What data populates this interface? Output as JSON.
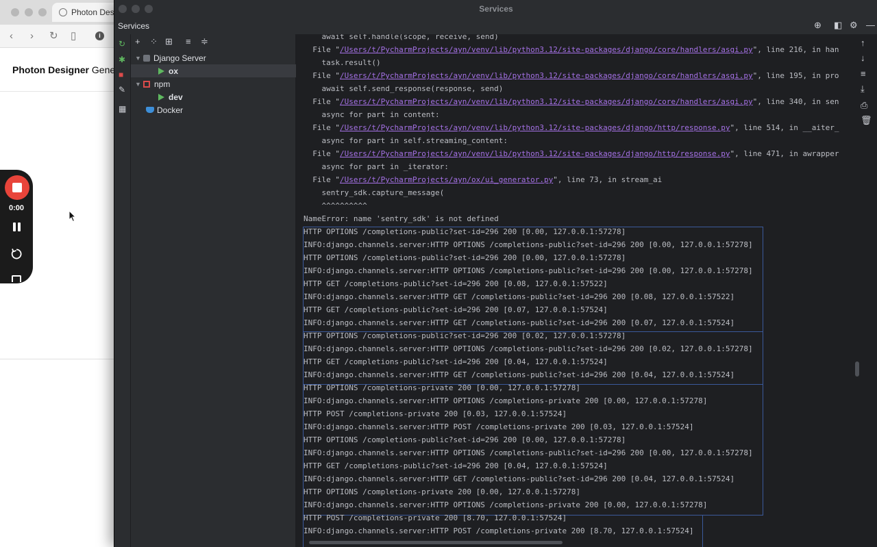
{
  "browser": {
    "tab_title": "Photon Desi",
    "site_brand": "Photon Designer",
    "site_title_rest": " Gene"
  },
  "recorder": {
    "time": "0:00"
  },
  "ide": {
    "window_title": "Services",
    "panel_label": "Services",
    "tree": [
      {
        "label": "Django Server",
        "type": "group"
      },
      {
        "label": "ox",
        "type": "run"
      },
      {
        "label": "npm",
        "type": "group"
      },
      {
        "label": "dev",
        "type": "run"
      },
      {
        "label": "Docker",
        "type": "docker"
      }
    ],
    "console": {
      "traceback": [
        {
          "pre": "    await self.handle(scope, receive, send)",
          "link": "",
          "post": ""
        },
        {
          "pre": "  File \"",
          "link": "/Users/t/PycharmProjects/ayn/venv/lib/python3.12/site-packages/django/core/handlers/asgi.py",
          "post": "\", line 216, in han"
        },
        {
          "pre": "    task.result()",
          "link": "",
          "post": ""
        },
        {
          "pre": "  File \"",
          "link": "/Users/t/PycharmProjects/ayn/venv/lib/python3.12/site-packages/django/core/handlers/asgi.py",
          "post": "\", line 195, in pro"
        },
        {
          "pre": "    await self.send_response(response, send)",
          "link": "",
          "post": ""
        },
        {
          "pre": "  File \"",
          "link": "/Users/t/PycharmProjects/ayn/venv/lib/python3.12/site-packages/django/core/handlers/asgi.py",
          "post": "\", line 340, in sen"
        },
        {
          "pre": "    async for part in content:",
          "link": "",
          "post": ""
        },
        {
          "pre": "  File \"",
          "link": "/Users/t/PycharmProjects/ayn/venv/lib/python3.12/site-packages/django/http/response.py",
          "post": "\", line 514, in __aiter_"
        },
        {
          "pre": "    async for part in self.streaming_content:",
          "link": "",
          "post": ""
        },
        {
          "pre": "  File \"",
          "link": "/Users/t/PycharmProjects/ayn/venv/lib/python3.12/site-packages/django/http/response.py",
          "post": "\", line 471, in awrapper"
        },
        {
          "pre": "    async for part in _iterator:",
          "link": "",
          "post": ""
        },
        {
          "pre": "  File \"",
          "link": "/Users/t/PycharmProjects/ayn/ox/ui_generator.py",
          "post": "\", line 73, in stream_ai"
        },
        {
          "pre": "    sentry_sdk.capture_message(",
          "link": "",
          "post": ""
        },
        {
          "pre": "    ^^^^^^^^^^",
          "link": "",
          "post": ""
        },
        {
          "pre": "NameError: name 'sentry_sdk' is not defined",
          "link": "",
          "post": ""
        }
      ],
      "log_lines": [
        "HTTP OPTIONS /completions-public?set-id=296 200 [0.00, 127.0.0.1:57278]",
        "INFO:django.channels.server:HTTP OPTIONS /completions-public?set-id=296 200 [0.00, 127.0.0.1:57278]",
        "HTTP OPTIONS /completions-public?set-id=296 200 [0.00, 127.0.0.1:57278]",
        "INFO:django.channels.server:HTTP OPTIONS /completions-public?set-id=296 200 [0.00, 127.0.0.1:57278]",
        "HTTP GET /completions-public?set-id=296 200 [0.08, 127.0.0.1:57522]",
        "INFO:django.channels.server:HTTP GET /completions-public?set-id=296 200 [0.08, 127.0.0.1:57522]",
        "HTTP GET /completions-public?set-id=296 200 [0.07, 127.0.0.1:57524]",
        "INFO:django.channels.server:HTTP GET /completions-public?set-id=296 200 [0.07, 127.0.0.1:57524]",
        "HTTP OPTIONS /completions-public?set-id=296 200 [0.02, 127.0.0.1:57278]",
        "INFO:django.channels.server:HTTP OPTIONS /completions-public?set-id=296 200 [0.02, 127.0.0.1:57278]",
        "HTTP GET /completions-public?set-id=296 200 [0.04, 127.0.0.1:57524]",
        "INFO:django.channels.server:HTTP GET /completions-public?set-id=296 200 [0.04, 127.0.0.1:57524]",
        "HTTP OPTIONS /completions-private 200 [0.00, 127.0.0.1:57278]",
        "INFO:django.channels.server:HTTP OPTIONS /completions-private 200 [0.00, 127.0.0.1:57278]",
        "HTTP POST /completions-private 200 [0.03, 127.0.0.1:57524]",
        "INFO:django.channels.server:HTTP POST /completions-private 200 [0.03, 127.0.0.1:57524]",
        "HTTP OPTIONS /completions-public?set-id=296 200 [0.00, 127.0.0.1:57278]",
        "INFO:django.channels.server:HTTP OPTIONS /completions-public?set-id=296 200 [0.00, 127.0.0.1:57278]",
        "HTTP GET /completions-public?set-id=296 200 [0.04, 127.0.0.1:57524]",
        "INFO:django.channels.server:HTTP GET /completions-public?set-id=296 200 [0.04, 127.0.0.1:57524]",
        "HTTP OPTIONS /completions-private 200 [0.00, 127.0.0.1:57278]",
        "INFO:django.channels.server:HTTP OPTIONS /completions-private 200 [0.00, 127.0.0.1:57278]",
        "HTTP POST /completions-private 200 [8.70, 127.0.0.1:57524]",
        "INFO:django.channels.server:HTTP POST /completions-private 200 [8.70, 127.0.0.1:57524]"
      ]
    }
  },
  "colors": {
    "link": "#a571e6",
    "run_green": "#5fb860",
    "record_red": "#e8443a",
    "box_border": "#3b5a9c"
  }
}
